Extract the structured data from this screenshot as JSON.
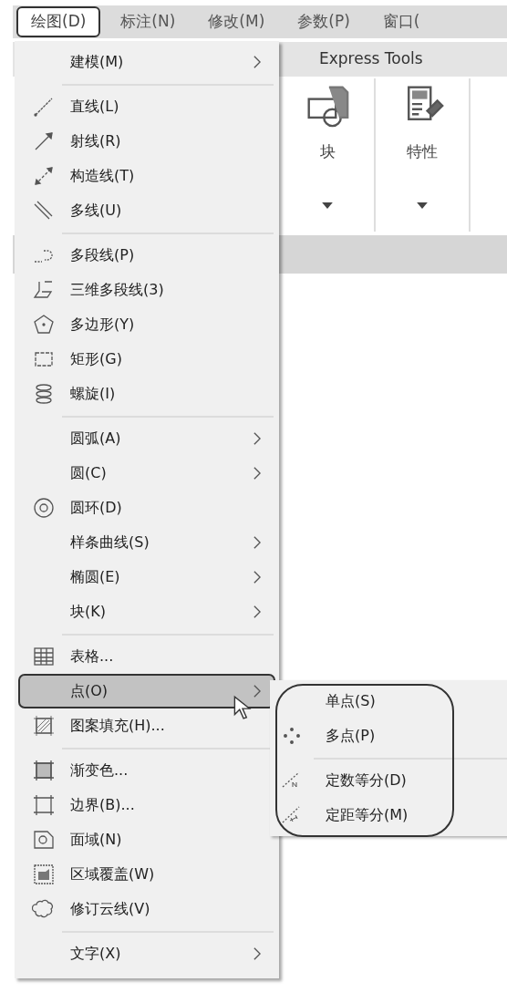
{
  "menubar": [
    {
      "label": "绘图(D)",
      "selected": true
    },
    {
      "label": "标注(N)",
      "selected": false
    },
    {
      "label": "修改(M)",
      "selected": false
    },
    {
      "label": "参数(P)",
      "selected": false
    },
    {
      "label": "窗口(",
      "selected": false
    }
  ],
  "ribbon": {
    "tab": "Express Tools",
    "panels": [
      {
        "label": "块"
      },
      {
        "label": "特性"
      }
    ]
  },
  "menu": {
    "items": [
      {
        "kind": "item",
        "label": "建模(M)",
        "has_submenu": true,
        "selected": false
      },
      {
        "kind": "separator"
      },
      {
        "kind": "item",
        "label": "直线(L)",
        "has_submenu": false,
        "selected": false
      },
      {
        "kind": "item",
        "label": "射线(R)",
        "has_submenu": false,
        "selected": false
      },
      {
        "kind": "item",
        "label": "构造线(T)",
        "has_submenu": false,
        "selected": false
      },
      {
        "kind": "item",
        "label": "多线(U)",
        "has_submenu": false,
        "selected": false
      },
      {
        "kind": "separator"
      },
      {
        "kind": "item",
        "label": "多段线(P)",
        "has_submenu": false,
        "selected": false
      },
      {
        "kind": "item",
        "label": "三维多段线(3)",
        "has_submenu": false,
        "selected": false
      },
      {
        "kind": "item",
        "label": "多边形(Y)",
        "has_submenu": false,
        "selected": false
      },
      {
        "kind": "item",
        "label": "矩形(G)",
        "has_submenu": false,
        "selected": false
      },
      {
        "kind": "item",
        "label": "螺旋(I)",
        "has_submenu": false,
        "selected": false
      },
      {
        "kind": "separator"
      },
      {
        "kind": "item",
        "label": "圆弧(A)",
        "has_submenu": true,
        "selected": false
      },
      {
        "kind": "item",
        "label": "圆(C)",
        "has_submenu": true,
        "selected": false
      },
      {
        "kind": "item",
        "label": "圆环(D)",
        "has_submenu": false,
        "selected": false
      },
      {
        "kind": "item",
        "label": "样条曲线(S)",
        "has_submenu": true,
        "selected": false
      },
      {
        "kind": "item",
        "label": "椭圆(E)",
        "has_submenu": true,
        "selected": false
      },
      {
        "kind": "item",
        "label": "块(K)",
        "has_submenu": true,
        "selected": false
      },
      {
        "kind": "separator"
      },
      {
        "kind": "item",
        "label": "表格...",
        "has_submenu": false,
        "selected": false
      },
      {
        "kind": "item",
        "label": "点(O)",
        "has_submenu": true,
        "selected": true
      },
      {
        "kind": "item",
        "label": "图案填充(H)...",
        "has_submenu": false,
        "selected": false
      },
      {
        "kind": "separator"
      },
      {
        "kind": "item",
        "label": "渐变色...",
        "has_submenu": false,
        "selected": false
      },
      {
        "kind": "item",
        "label": "边界(B)...",
        "has_submenu": false,
        "selected": false
      },
      {
        "kind": "item",
        "label": "面域(N)",
        "has_submenu": false,
        "selected": false
      },
      {
        "kind": "item",
        "label": "区域覆盖(W)",
        "has_submenu": false,
        "selected": false
      },
      {
        "kind": "item",
        "label": "修订云线(V)",
        "has_submenu": false,
        "selected": false
      },
      {
        "kind": "separator"
      },
      {
        "kind": "item",
        "label": "文字(X)",
        "has_submenu": true,
        "selected": false
      }
    ]
  },
  "submenu": {
    "items": [
      {
        "kind": "item",
        "label": "单点(S)",
        "selected": false
      },
      {
        "kind": "item",
        "label": "多点(P)",
        "selected": false
      },
      {
        "kind": "separator"
      },
      {
        "kind": "item",
        "label": "定数等分(D)",
        "selected": false
      },
      {
        "kind": "item",
        "label": "定距等分(M)",
        "selected": false
      }
    ]
  }
}
